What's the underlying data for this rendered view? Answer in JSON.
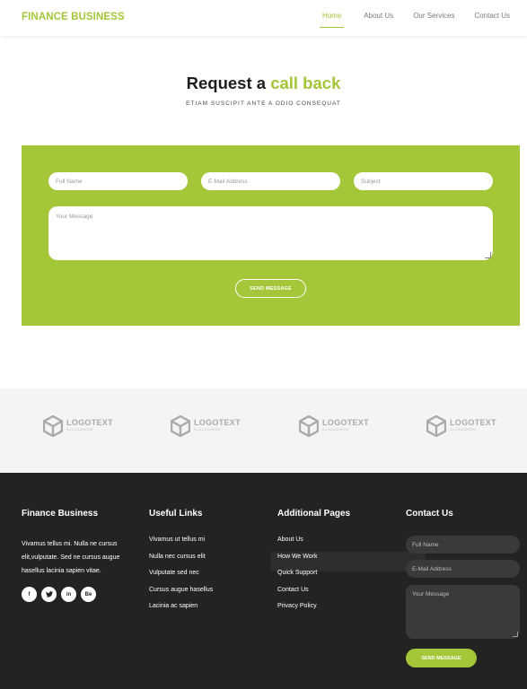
{
  "header": {
    "brand": "FINANCE BUSINESS",
    "nav": [
      "Home",
      "About Us",
      "Our Services",
      "Contact Us"
    ],
    "active_nav": "Home"
  },
  "request": {
    "title_plain": "Request a",
    "title_accent": "call back",
    "subtitle": "ETIAM SUSCIPIT ANTE A ODIO CONSEQUAT",
    "placeholders": {
      "full_name": "Full Name",
      "email": "E-Mail Address",
      "subject": "Subject",
      "message": "Your Message"
    },
    "send_label": "SEND MESSAGE"
  },
  "logos": [
    {
      "text": "LOGOTEXT",
      "slogan": "SLOGANHERE"
    },
    {
      "text": "LOGOTEXT",
      "slogan": "SLOGANHERE"
    },
    {
      "text": "LOGOTEXT",
      "slogan": "SLOGANHERE"
    },
    {
      "text": "LOGOTEXT",
      "slogan": "SLOGANHERE"
    }
  ],
  "footer": {
    "about": {
      "heading": "Finance Business",
      "text": "Vivamus tellus mi. Nulla ne cursus elit,vulputate. Sed ne cursus augue hasellus lacinia sapien vitae.",
      "socials": [
        "f",
        "t",
        "in",
        "Be"
      ]
    },
    "useful_links": {
      "heading": "Useful Links",
      "items": [
        "Vivamus ut tellus mi",
        "Nulla nec cursus elit",
        "Vulputate sed nec",
        "Cursus augue hasellus",
        "Lacinia ac sapien"
      ]
    },
    "additional_pages": {
      "heading": "Additional Pages",
      "items": [
        "About Us",
        "How We Work",
        "Quick Support",
        "Contact Us",
        "Privacy Policy"
      ]
    },
    "contact": {
      "heading": "Contact Us",
      "placeholders": {
        "full_name": "Full Name",
        "email": "E-Mail Address",
        "message": "Your Message"
      },
      "send_label": "SEND MESSAGE"
    }
  },
  "colors": {
    "accent": "#a4c639",
    "footer_bg": "#232323",
    "logos_bg": "#f4f4f4"
  }
}
